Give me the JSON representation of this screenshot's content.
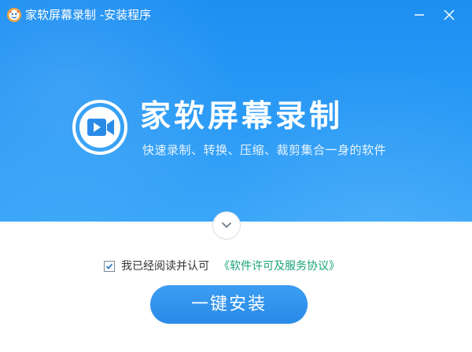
{
  "window": {
    "title": "家软屏幕录制 -安装程序"
  },
  "hero": {
    "product_name": "家软屏幕录制",
    "tagline": "快速录制、转换、压缩、裁剪集合一身的软件"
  },
  "agreement": {
    "checked": true,
    "label": "我已经阅读并认可",
    "link_text": "《软件许可及服务协议》"
  },
  "install_button": {
    "label": "一键安装"
  },
  "colors": {
    "hero_blue": "#2b9bf6",
    "button_blue": "#2a8ae8",
    "link_green": "#1aa37a"
  },
  "icons": {
    "app": "app-logo-icon",
    "minimize": "minimize-icon",
    "close": "close-icon",
    "logo": "video-camera-icon",
    "expand": "chevron-down-icon",
    "check": "checkmark-icon"
  }
}
